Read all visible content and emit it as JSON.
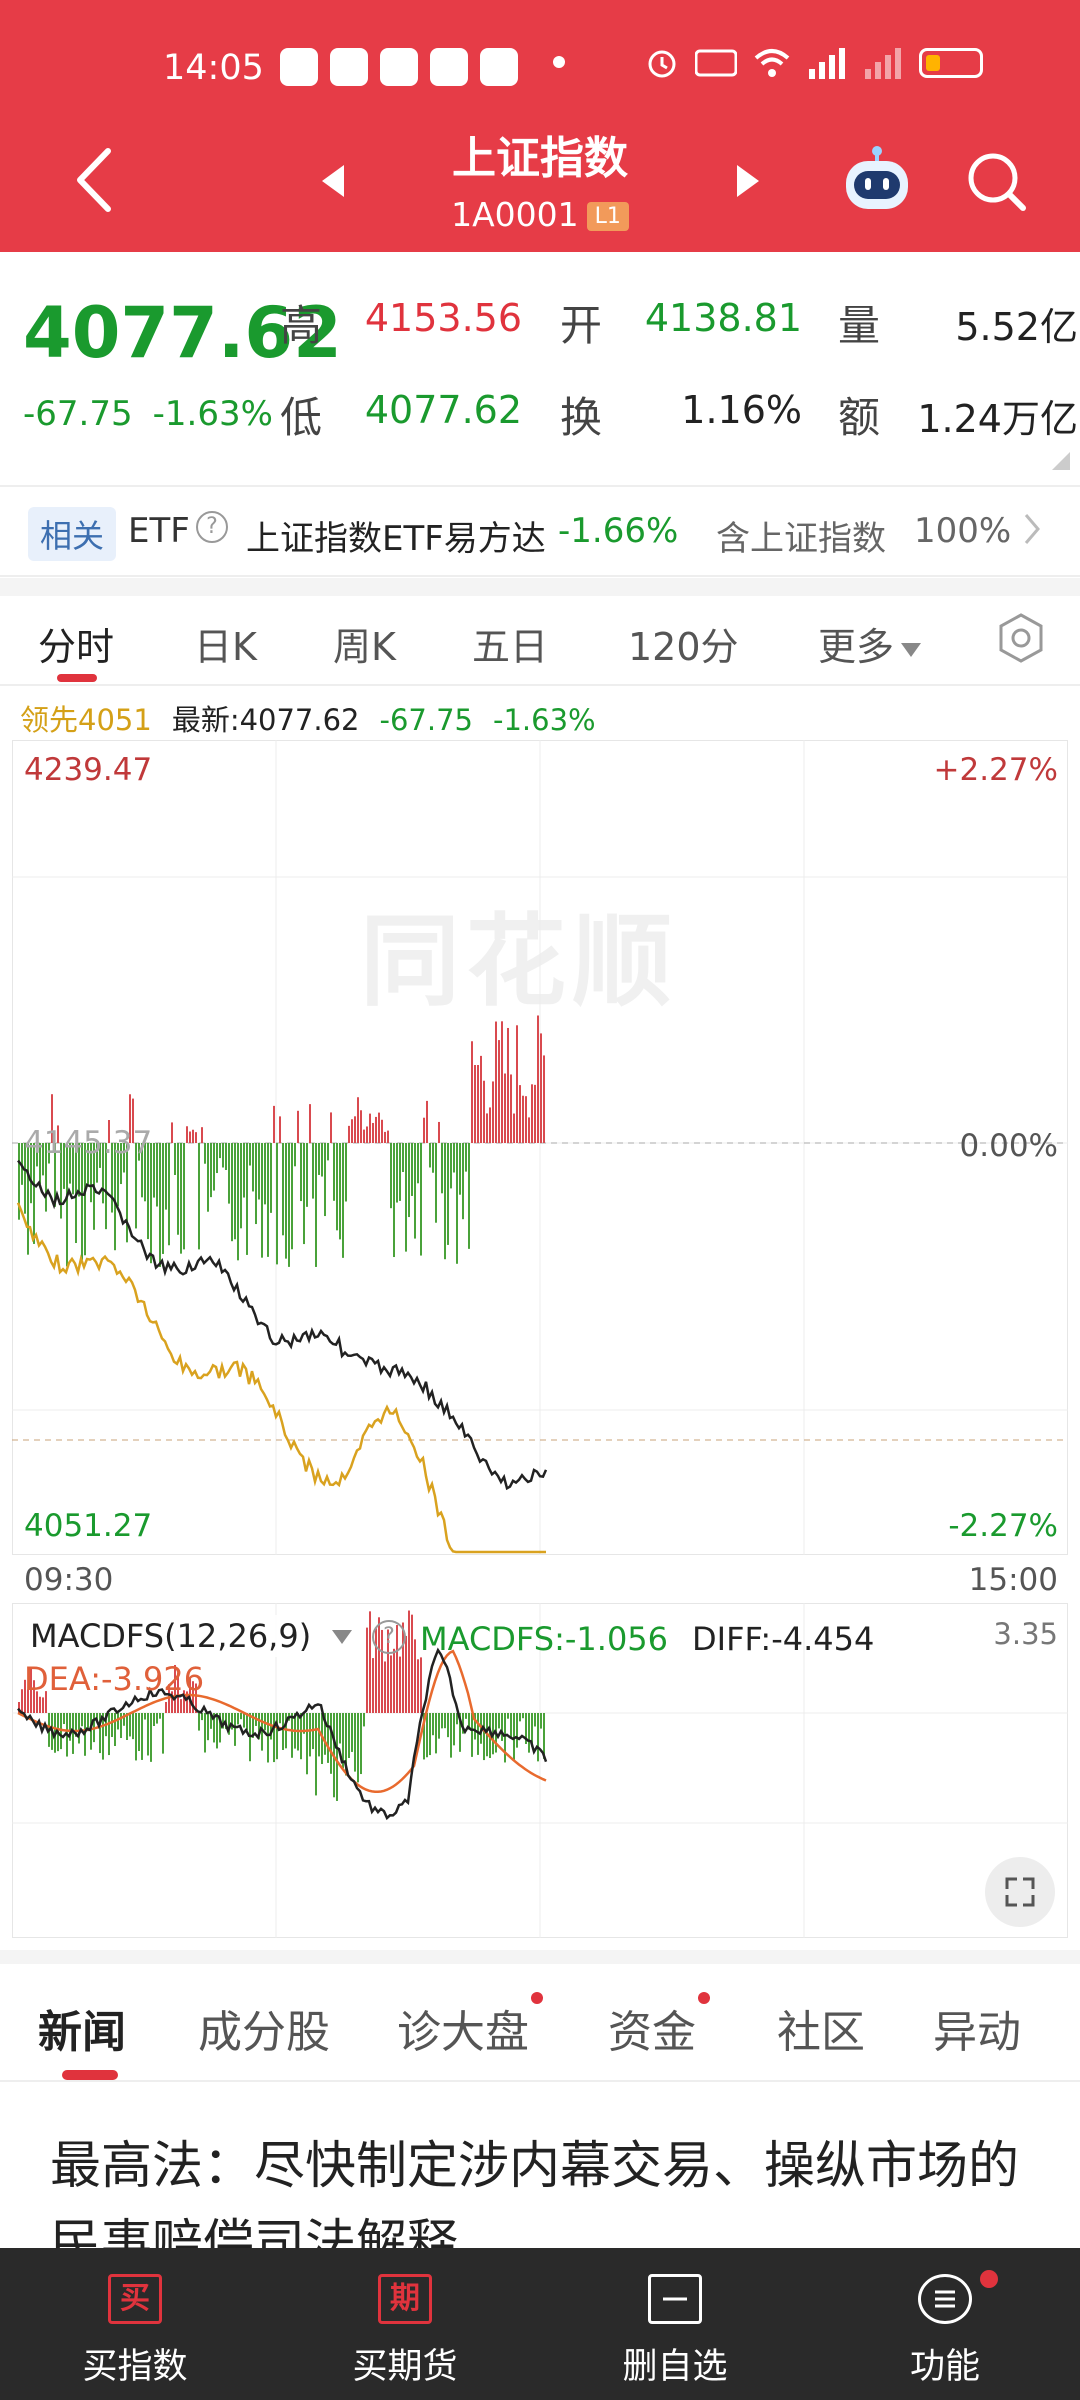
{
  "status_bar": {
    "time": "14:05"
  },
  "header": {
    "title": "上证指数",
    "code": "1A0001",
    "badge": "L1"
  },
  "quote": {
    "price": "4077.62",
    "change": "-67.75",
    "change_pct": "-1.63%",
    "high_label": "高",
    "high_val": "4153.56",
    "open_label": "开",
    "open_val": "4138.81",
    "vol_label": "量",
    "vol_val": "5.52亿",
    "low_label": "低",
    "low_val": "4077.62",
    "turnover_label": "换",
    "turnover_val": "1.16%",
    "amount_label": "额",
    "amount_val": "1.24万亿"
  },
  "etf": {
    "tag": "相关",
    "label": "ETF",
    "help": "?",
    "name": "上证指数ETF易方达",
    "pct": "-1.66%",
    "hold_label": "含上证指数",
    "hold_pct": "100%"
  },
  "chart_tabs": [
    "分时",
    "日K",
    "周K",
    "五日",
    "120分",
    "更多"
  ],
  "info": {
    "leading": "领先4051",
    "latest": "最新:4077.62",
    "change": "-67.75",
    "change_pct": "-1.63%"
  },
  "chart_data": {
    "type": "line",
    "title": "",
    "ylim": [
      4051.27,
      4239.47
    ],
    "y_labels_left": [
      "4239.47",
      "4051.27"
    ],
    "y_labels_right": [
      "+2.27%",
      "0.00%",
      "-2.27%"
    ],
    "x_labels": [
      "09:30",
      "15:00"
    ],
    "watermark": "同花顺",
    "ref_value": "4145.37"
  },
  "macd": {
    "label": "MACDFS(12,26,9)",
    "help": "?",
    "macd_val": "MACDFS:-1.056",
    "diff_val": "DIFF:-4.454",
    "dea_val": "DEA:-3.926",
    "max_val": "3.35"
  },
  "news_tabs": [
    "新闻",
    "成分股",
    "诊大盘",
    "资金",
    "社区",
    "异动"
  ],
  "headline": "最高法：尽快制定涉内幕交易、操纵市场的民事赔偿司法解释",
  "bottom_bar": [
    {
      "icon": "买",
      "label": "买指数"
    },
    {
      "icon": "期",
      "label": "买期货"
    },
    {
      "icon": "",
      "label": "删自选"
    },
    {
      "icon": "",
      "label": "功能"
    }
  ]
}
